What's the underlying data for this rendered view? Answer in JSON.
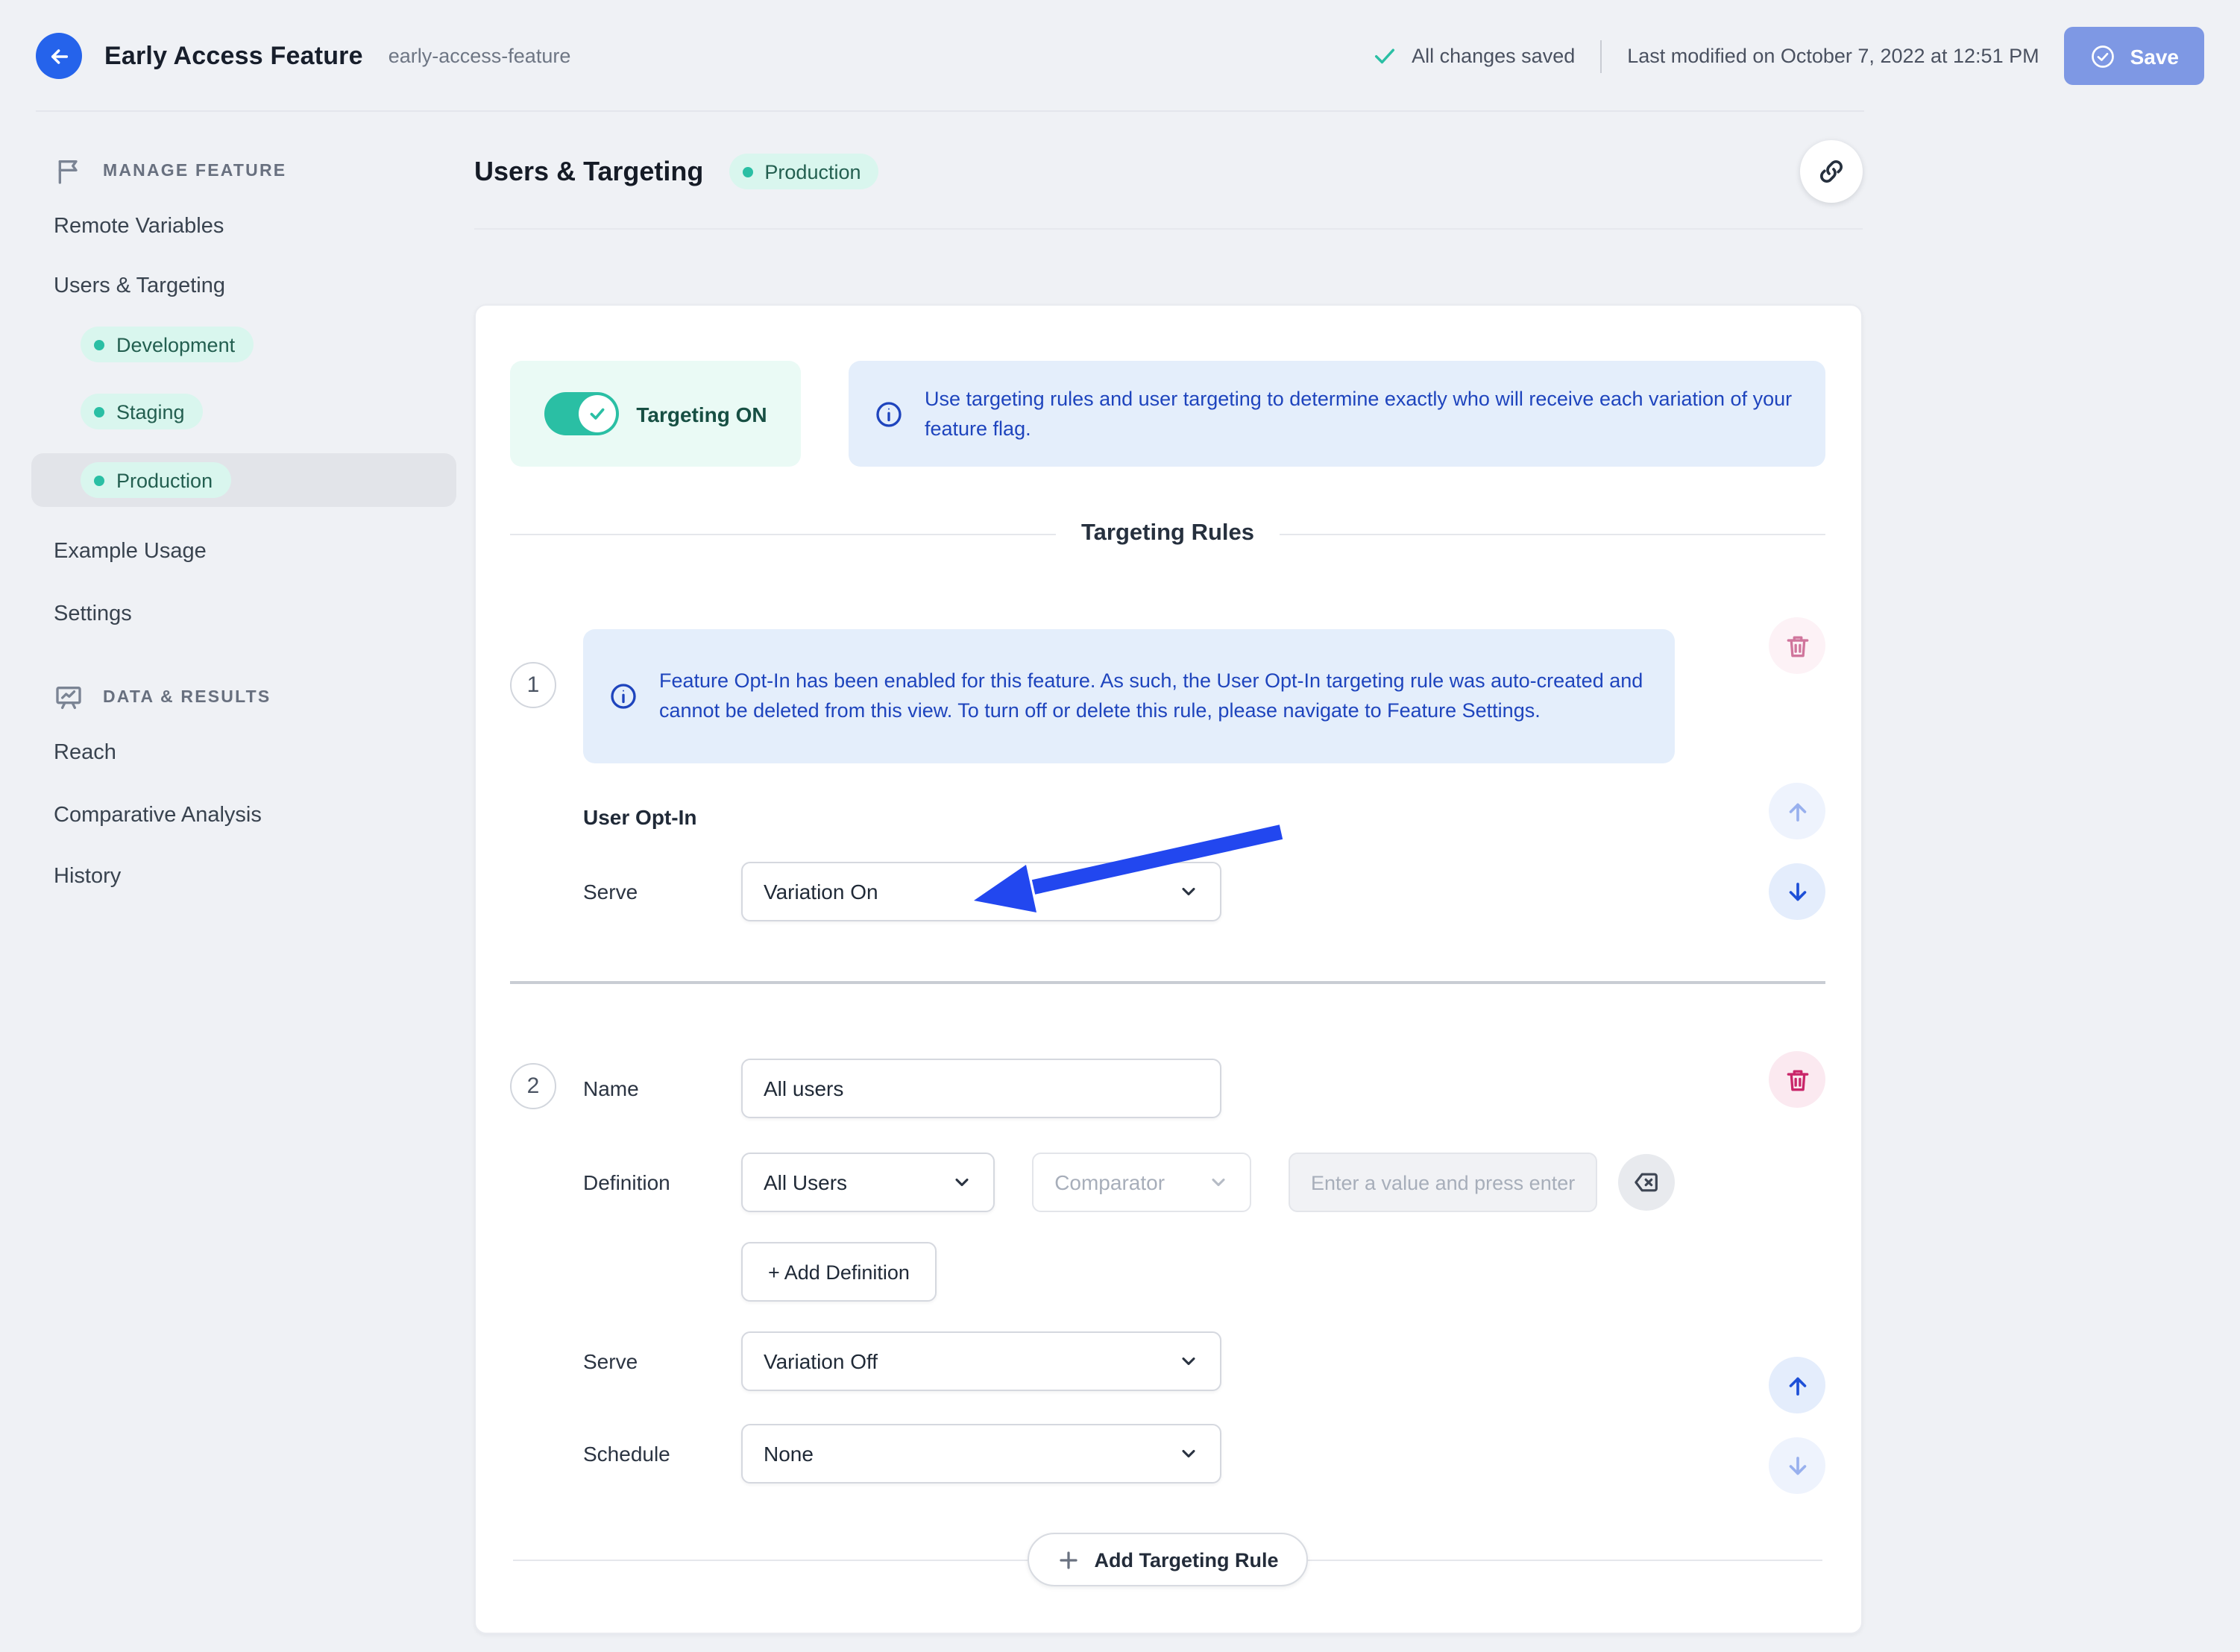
{
  "header": {
    "title": "Early Access Feature",
    "slug": "early-access-feature",
    "saved_status": "All changes saved",
    "last_modified": "Last modified on October 7, 2022 at 12:51 PM",
    "save_label": "Save"
  },
  "sidebar": {
    "manage_section_label": "MANAGE FEATURE",
    "data_section_label": "DATA & RESULTS",
    "items": {
      "remote_variables": "Remote Variables",
      "users_targeting": "Users & Targeting",
      "development": "Development",
      "staging": "Staging",
      "production": "Production",
      "example_usage": "Example Usage",
      "settings": "Settings",
      "reach": "Reach",
      "comparative_analysis": "Comparative Analysis",
      "history": "History"
    }
  },
  "page": {
    "title": "Users & Targeting",
    "environment_badge": "Production"
  },
  "toggle": {
    "label": "Targeting ON",
    "state": "on"
  },
  "info_banner": "Use targeting rules and user targeting to determine exactly who will receive each variation of your feature flag.",
  "rules": {
    "heading": "Targeting Rules",
    "rule1": {
      "number": "1",
      "info": "Feature Opt-In has been enabled for this feature. As such, the User Opt-In targeting rule was auto-created and cannot be deleted from this view. To turn off or delete this rule, please navigate to Feature Settings.",
      "name": "User Opt-In",
      "serve_label": "Serve",
      "serve_value": "Variation On"
    },
    "rule2": {
      "number": "2",
      "name_label": "Name",
      "name_value": "All users",
      "definition_label": "Definition",
      "definition_value": "All Users",
      "comparator_placeholder": "Comparator",
      "value_placeholder": "Enter a value and press enter...",
      "add_definition_label": "+ Add Definition",
      "serve_label": "Serve",
      "serve_value": "Variation Off",
      "schedule_label": "Schedule",
      "schedule_value": "None"
    },
    "add_rule_label": "Add Targeting Rule"
  },
  "icons": {
    "back": "arrow-left-icon",
    "saved_check": "check-icon",
    "save_button": "circle-check-icon",
    "manage_section": "flag-icon",
    "data_section": "presentation-chart-icon",
    "share": "link-icon",
    "toggle_knob": "check-icon",
    "banners": "info-circle-icon",
    "delete_rule": "trash-icon",
    "reorder_up": "arrow-up-icon",
    "reorder_down": "arrow-down-icon",
    "dropdown": "chevron-down-icon",
    "clear_definition": "backspace-icon",
    "add_rule": "plus-icon"
  },
  "colors": {
    "page_bg": "#eff1f5",
    "primary_blue": "#2563eb",
    "save_disabled_blue": "#7e98e4",
    "accent_teal": "#2abfa4",
    "mint_bg": "#d9f6ee",
    "info_bg": "#e4eefb",
    "info_text": "#1e44bd",
    "danger_pink": "#c92569",
    "annotation_arrow_blue": "#2247ef"
  }
}
